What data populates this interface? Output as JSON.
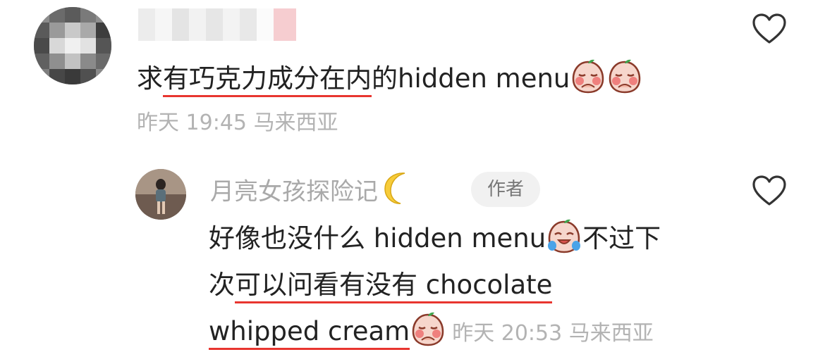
{
  "comment": {
    "text_prefix": "求",
    "text_underlined": "有巧克力成分在内",
    "text_suffix": "的hidden menu",
    "emojis": [
      "peach-crying-emoji",
      "peach-crying-emoji"
    ],
    "date": "昨天",
    "time": "19:45",
    "location": "马来西亚"
  },
  "reply": {
    "username": "月亮女孩探险记",
    "author_badge": "作者",
    "line1_text": "好像也没什么 hidden menu",
    "line1_after": "不过下",
    "line2_prefix": "次",
    "line2_underlined": "可以问看有没有 chocolate",
    "line3_underlined": "whipped cream",
    "date": "昨天",
    "time": "20:53",
    "location": "马来西亚"
  },
  "colors": {
    "underline": "#e8352f",
    "meta": "#b3b3b3"
  }
}
